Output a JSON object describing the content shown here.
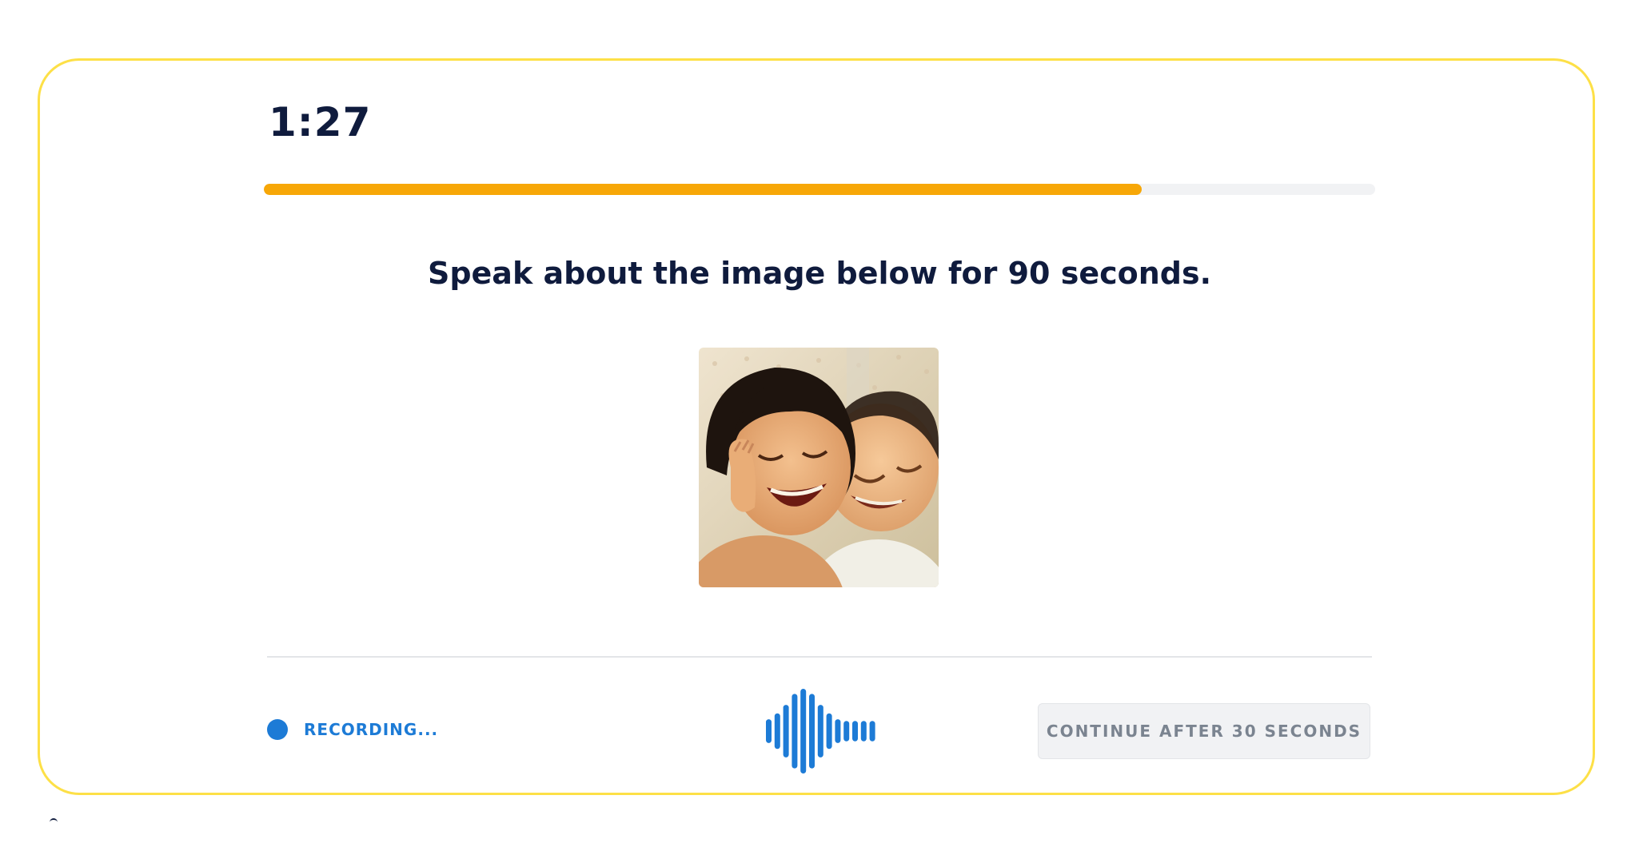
{
  "timer": {
    "value": "1:27"
  },
  "progress": {
    "fraction": 0.79,
    "fill_color": "#f7a707",
    "track_color": "#f1f2f4"
  },
  "prompt": {
    "text": "Speak about the image below for 90 seconds."
  },
  "image": {
    "subject": "two-smiling-children-photo"
  },
  "recording": {
    "label": "RECORDING...",
    "color": "#1d7bd6"
  },
  "waveform": {
    "levels": [
      0.28,
      0.42,
      0.62,
      0.88,
      1.0,
      0.88,
      0.62,
      0.42,
      0.28,
      0.24,
      0.24,
      0.24,
      0.24
    ],
    "color": "#1d7bd6"
  },
  "continue_button": {
    "label": "CONTINUE AFTER 30 SECONDS",
    "disabled": true
  },
  "theme": {
    "card_border": "#fde047",
    "text_dark": "#0f1b3d"
  }
}
